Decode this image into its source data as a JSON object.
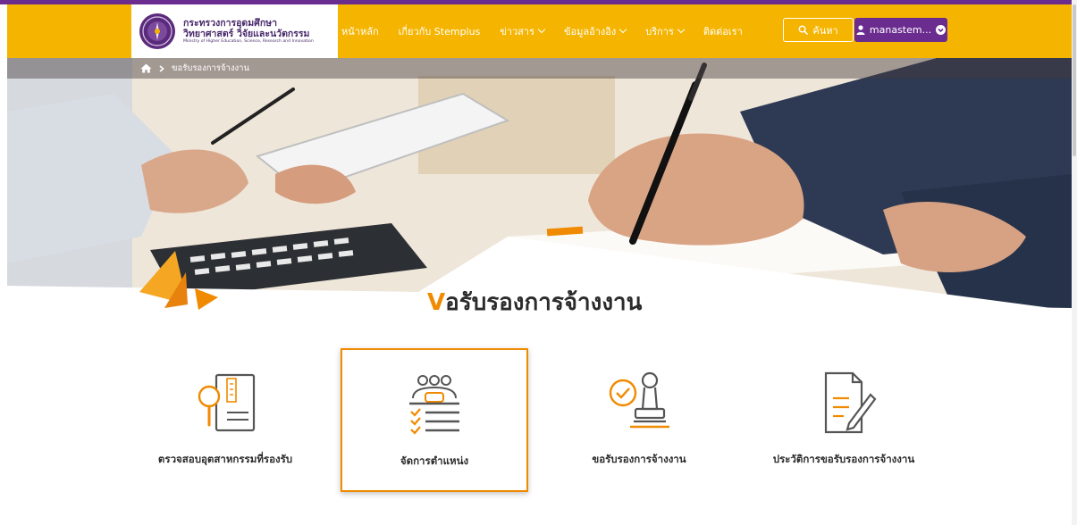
{
  "logo": {
    "line1": "กระทรวงการอุดมศึกษา",
    "line2": "วิทยาศาสตร์ วิจัยและนวัตกรรม",
    "line3": "Ministry of Higher Education, Science, Research and Innovation"
  },
  "nav": {
    "home": "หน้าหลัก",
    "about": "เกี่ยวกับ Stemplus",
    "news": "ข่าวสาร",
    "references": "ข้อมูลอ้างอิง",
    "services": "บริการ",
    "contact": "ติดต่อเรา"
  },
  "search": {
    "label": "ค้นหา"
  },
  "user": {
    "name": "manastem..."
  },
  "breadcrumb": {
    "current": "ขอรับรองการจ้างงาน"
  },
  "page": {
    "title_first": "V",
    "title_rest": "อรับรองการจ้างงาน"
  },
  "cards": [
    {
      "label": "ตรวจสอบอุตสาหกรรมที่รองรับ",
      "icon": "document-search-icon"
    },
    {
      "label": "จัดการตำแหน่ง",
      "icon": "meeting-checklist-icon"
    },
    {
      "label": "ขอรับรองการจ้างงาน",
      "icon": "stamp-approval-icon"
    },
    {
      "label": "ประวัติการขอรับรองการจ้างงาน",
      "icon": "document-edit-icon"
    }
  ],
  "colors": {
    "accent": "#f5b400",
    "brand": "#6b2c8f",
    "orange": "#f08a00"
  }
}
